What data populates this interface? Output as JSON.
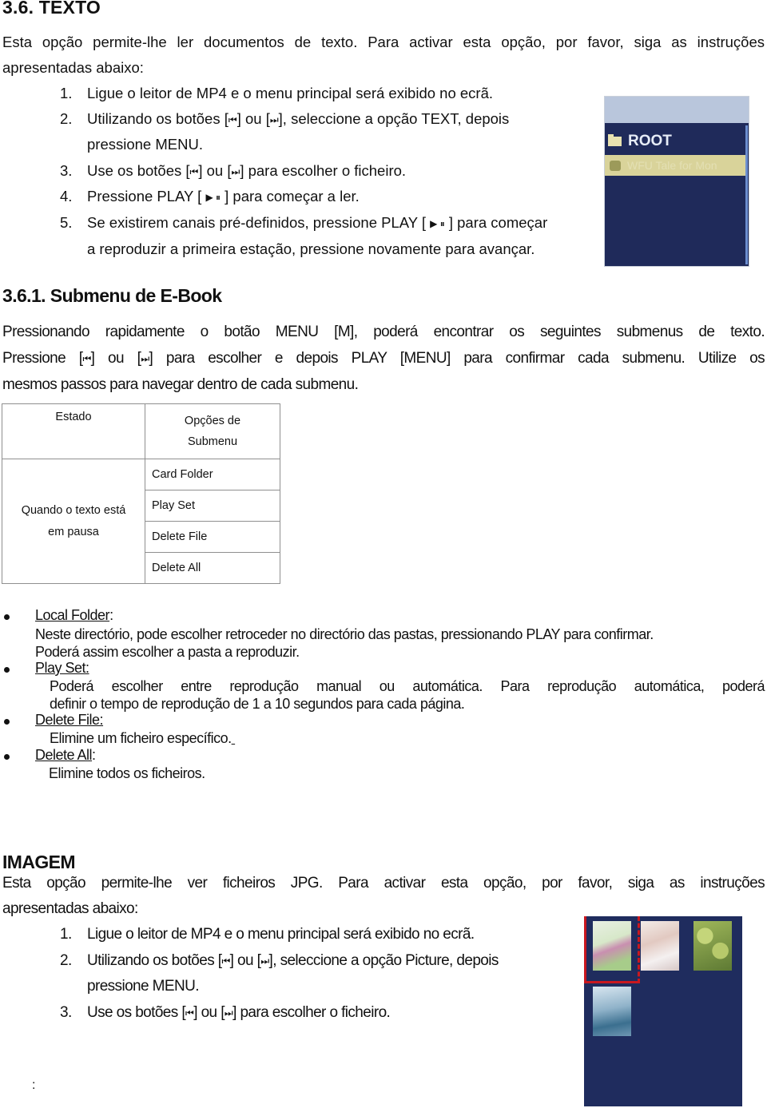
{
  "section_texto": {
    "title": "3.6.  TEXTO",
    "intro_line1": "Esta opção permite-lhe ler documentos de texto. Para activar esta opção, por favor, siga as instruções",
    "intro_line2": "apresentadas abaixo:",
    "steps": [
      {
        "num": "1.",
        "text": "Ligue o leitor de MP4 e o menu principal será exibido no ecrã."
      },
      {
        "num": "2.",
        "text_a": "Utilizando os botões [",
        "prev_icon": "⏮",
        "text_b": "] ou [",
        "next_icon": "⏭",
        "text_c": "], seleccione a opção TEXT, depois",
        "cont": "pressione MENU."
      },
      {
        "num": "3.",
        "text_a": "Use os botões [",
        "prev_icon": "⏮",
        "text_b": "] ou [",
        "next_icon": "⏭",
        "text_c": "] para escolher o ficheiro."
      },
      {
        "num": "4.",
        "text_a": "Pressione PLAY [ ",
        "play_icon": "▶ ⏸",
        "text_b": " ] para começar a ler."
      },
      {
        "num": "5.",
        "text_a": "Se existirem canais pré-definidos, pressione PLAY [ ",
        "play_icon": "▶ ⏸",
        "text_b": " ] para começar",
        "cont": "a reproduzir a primeira estação, pressione novamente para avançar."
      }
    ],
    "screen": {
      "root_label": "ROOT",
      "selected_item": "WFU Tale for Mon"
    }
  },
  "section_submenu": {
    "title": "3.6.1.  Submenu de E-Book",
    "para_line1": "Pressionando rapidamente o botão MENU [M], poderá encontrar os seguintes submenus de texto.",
    "para_line2_a": "Pressione [",
    "para_line2_b": "] ou [",
    "para_line2_c": "] para escolher e depois PLAY [MENU] para confirmar cada submenu. Utilize os",
    "para_line3": "mesmos passos para navegar dentro de cada submenu.",
    "prev_icon": "⏮",
    "next_icon": "⏭",
    "table": {
      "headers": [
        "Estado",
        "Opções de",
        "Submenu"
      ],
      "state": [
        "Quando o texto está",
        "em pausa"
      ],
      "options": [
        "Card Folder",
        "Play Set",
        "Delete File",
        "Delete All"
      ]
    },
    "bullets": [
      {
        "label": "Local Folder",
        "suffix": ":",
        "lines": [
          "Neste directório, pode escolher retroceder no directório das pastas, pressionando PLAY para confirmar.",
          "Poderá assim escolher a pasta a reproduzir."
        ]
      },
      {
        "label": "Play Set:",
        "suffix": "",
        "lines": [
          "Poderá escolher entre reprodução manual ou automática. Para reprodução automática, poderá",
          "definir o tempo de reprodução de 1 a 10 segundos para cada página."
        ]
      },
      {
        "label": "Delete File:",
        "suffix": "",
        "lines": [
          "Elimine um ficheiro específico."
        ]
      },
      {
        "label": "Delete All",
        "suffix": ":",
        "lines": [
          "Elimine todos os ficheiros."
        ]
      }
    ]
  },
  "section_imagem": {
    "title": "IMAGEM",
    "intro_line1": "Esta opção permite-lhe ver ficheiros JPG. Para activar esta opção, por favor, siga as instruções",
    "intro_line2": "apresentadas abaixo:",
    "steps": [
      {
        "num": "1.",
        "text": "Ligue o leitor de MP4 e o menu principal será exibido no ecrã."
      },
      {
        "num": "2.",
        "text_a": "Utilizando os botões [",
        "text_b": "] ou [",
        "text_c": "], seleccione a opção Picture, depois",
        "cont": "pressione MENU."
      },
      {
        "num": "3.",
        "text_a": "Use os botões [",
        "text_b": "] ou [",
        "text_c": "] para escolher o ficheiro."
      }
    ],
    "prev_icon": "⏮",
    "next_icon": "⏭",
    "footer_mark": ":"
  }
}
